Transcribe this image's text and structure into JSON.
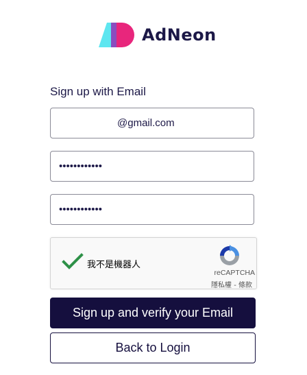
{
  "brand": {
    "name": "AdNeon",
    "colors": {
      "cyan": "#5ee6f0",
      "pink": "#e8267c",
      "navy": "#150f3e"
    }
  },
  "form": {
    "heading": "Sign up with Email",
    "email_value": "@gmail.com",
    "password_value": "••••••••••••",
    "confirm_password_value": "••••••••••••"
  },
  "captcha": {
    "label": "我不是機器人",
    "brand": "reCAPTCHA",
    "links": "隱私權 - 條款",
    "checked": true,
    "check_color": "#2e9148"
  },
  "buttons": {
    "signup_label": "Sign up and verify your Email",
    "back_label": "Back to Login"
  },
  "icons": {
    "logo": "adneon-logo-icon",
    "checkmark": "checkmark-icon",
    "recaptcha": "recaptcha-icon"
  }
}
